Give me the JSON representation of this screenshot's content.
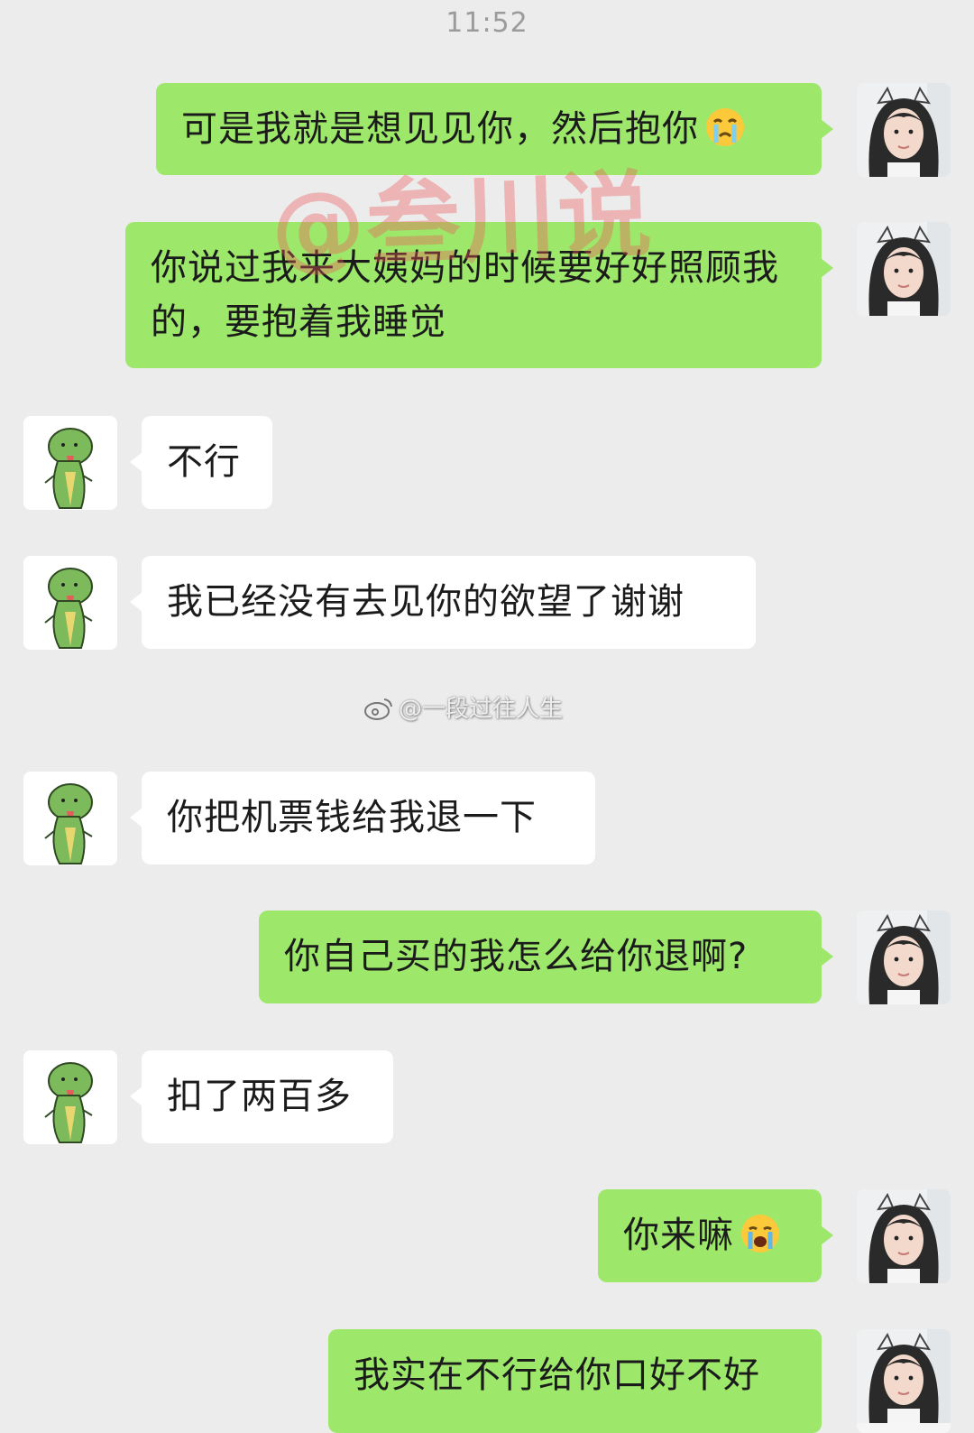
{
  "status_bar": {
    "time": "11:52"
  },
  "watermarks": {
    "main": "@叁川说",
    "weibo": "@一段过往人生"
  },
  "messages": [
    {
      "sender": "me",
      "text": "可是我就是想见见你，然后抱你",
      "emoji": "crying-face-icon"
    },
    {
      "sender": "me",
      "text": "你说过我来大姨妈的时候要好好照顾我的，要抱着我睡觉"
    },
    {
      "sender": "other",
      "text": "不行"
    },
    {
      "sender": "other",
      "text": "我已经没有去见你的欲望了谢谢"
    },
    {
      "sender": "other",
      "text": "你把机票钱给我退一下"
    },
    {
      "sender": "me",
      "text": "你自己买的我怎么给你退啊?"
    },
    {
      "sender": "other",
      "text": "扣了两百多"
    },
    {
      "sender": "me",
      "text": "你来嘛",
      "emoji": "loudly-crying-face-icon"
    },
    {
      "sender": "me",
      "text": "我实在不行给你口好不好"
    }
  ],
  "colors": {
    "background": "#ececec",
    "my_bubble": "#9de86b",
    "other_bubble": "#ffffff",
    "timestamp": "#9b9b9b"
  }
}
